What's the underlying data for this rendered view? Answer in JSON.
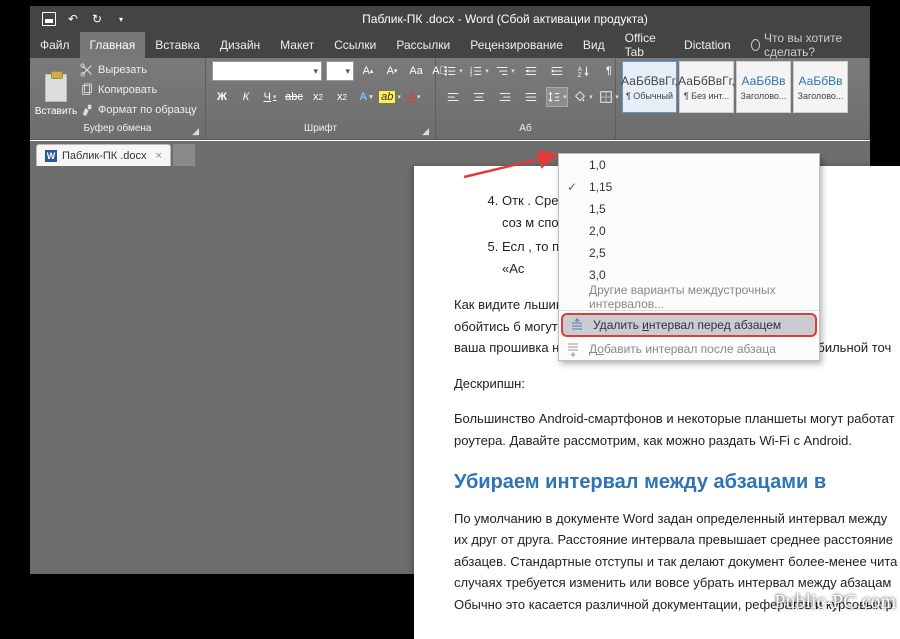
{
  "title": "Паблик-ПК .docx - Word (Сбой активации продукта)",
  "tabs": {
    "file": "Файл",
    "home": "Главная",
    "insert": "Вставка",
    "design": "Дизайн",
    "layout": "Макет",
    "references": "Ссылки",
    "mailings": "Рассылки",
    "review": "Рецензирование",
    "view": "Вид",
    "officetab": "Office Tab",
    "dictation": "Dictation"
  },
  "tell_me_placeholder": "Что вы хотите сделать?",
  "clipboard": {
    "paste": "Вставить",
    "cut": "Вырезать",
    "copy": "Копировать",
    "format_painter": "Формат по образцу",
    "group_label": "Буфер обмена"
  },
  "font": {
    "name": "",
    "size": "",
    "group_label": "Шрифт",
    "bold": "Ж",
    "italic": "К",
    "underline": "Ч",
    "strike": "abc"
  },
  "paragraph": {
    "group_label": "Аб"
  },
  "styles": {
    "sample": "АаБбВвГг,",
    "sample_h": "АаБбВв",
    "normal": "¶ Обычный",
    "no_spacing": "¶ Без инт...",
    "heading1": "Заголово...",
    "heading2": "Заголово..."
  },
  "doc_tab": {
    "name": "Паблик-ПК .docx"
  },
  "line_spacing_menu": {
    "v10": "1,0",
    "v115": "1,15",
    "v15": "1,5",
    "v20": "2,0",
    "v25": "2,5",
    "v30": "3,0",
    "more": "Другие варианты междустрочных интервалов...",
    "remove_before_pre": "Удалить ",
    "remove_before_u": "и",
    "remove_before_post": "нтервал перед абзацем",
    "add_after_pre": "Д",
    "add_after_u": "о",
    "add_after_post": "бавить интервал после абзаца"
  },
  "document": {
    "list_start": 4,
    "li4": "Отк                                                                                       . Среди них дол",
    "li4b": "соз                                                                                       м способом,",
    "li5": "Есл                                                                                       , то просто",
    "li5b": "«Ас",
    "p1": "Как видите                                                                                         льшинстве с",
    "p1b": "обойтись б                                                                                         могут быть",
    "p1c": "ваша прошивка не поддерживает возможность создания мобильной точ",
    "descr": "Дескрипшн:",
    "p2": "Большинство Android-смартфонов и некоторые планшеты могут работат",
    "p2b": "роутера. Давайте рассмотрим, как можно раздать Wi-Fi с Android.",
    "h": "Убираем интервал между абзацами в",
    "p3a": "По умолчанию в документе Word задан определенный интервал между",
    "p3b": "их друг от друга. Расстояние интервала превышает среднее расстояние",
    "p3c": "абзацев. Стандартные отступы и так делают документ более-менее чита",
    "p3d": "случаях требуется изменить или вовсе убрать интервал между абзацам",
    "p3e": "Обычно это касается различной документации, рефератов и курсовых р"
  },
  "watermark": "Public-PC.com"
}
